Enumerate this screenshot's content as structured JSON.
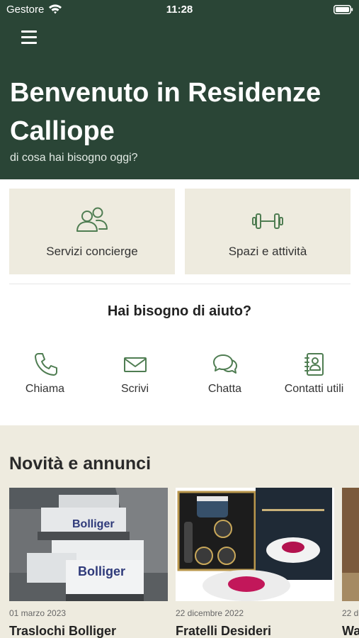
{
  "status_bar": {
    "carrier": "Gestore",
    "time": "11:28"
  },
  "header": {
    "title": "Benvenuto in Residenze Calliope",
    "subtitle": "di cosa hai bisogno oggi?"
  },
  "cards": [
    {
      "label": "Servizi concierge",
      "icon": "users-icon"
    },
    {
      "label": "Spazi e attività",
      "icon": "dumbbell-icon"
    }
  ],
  "help": {
    "title": "Hai bisogno di aiuto?",
    "items": [
      {
        "label": "Chiama",
        "icon": "phone-icon"
      },
      {
        "label": "Scrivi",
        "icon": "mail-icon"
      },
      {
        "label": "Chatta",
        "icon": "chat-icon"
      },
      {
        "label": "Contatti utili",
        "icon": "contacts-book-icon"
      }
    ]
  },
  "news": {
    "title": "Novità e annunci",
    "items": [
      {
        "date": "01 marzo 2023",
        "title": "Traslochi Bolliger",
        "image_text": "Bolliger"
      },
      {
        "date": "22 dicembre 2022",
        "title": "Fratelli Desideri"
      },
      {
        "date": "22 d",
        "title": "Wa"
      }
    ]
  },
  "colors": {
    "header_bg": "#2a4536",
    "accent_green": "#4f7d52",
    "card_bg": "#eeebdf"
  }
}
